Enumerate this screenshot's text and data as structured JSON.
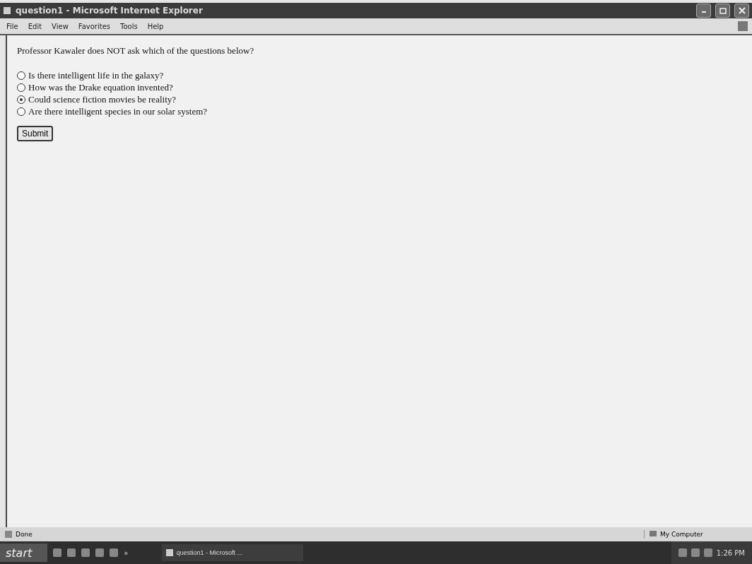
{
  "window": {
    "title": "question1 - Microsoft Internet Explorer"
  },
  "menu": [
    "File",
    "Edit",
    "View",
    "Favorites",
    "Tools",
    "Help"
  ],
  "question": "Professor Kawaler does NOT ask which of the questions below?",
  "options": [
    {
      "label": "Is there intelligent life in the galaxy?",
      "selected": false
    },
    {
      "label": "How was the Drake equation invented?",
      "selected": false
    },
    {
      "label": "Could science fiction movies be reality?",
      "selected": true
    },
    {
      "label": "Are there intelligent species in our solar system?",
      "selected": false
    }
  ],
  "submit": "Submit",
  "status_bar": {
    "status": "Done",
    "zone": "My Computer"
  },
  "taskbar": {
    "start": "start",
    "overflow": "»",
    "task": "question1 - Microsoft ...",
    "clock": "1:26 PM"
  }
}
